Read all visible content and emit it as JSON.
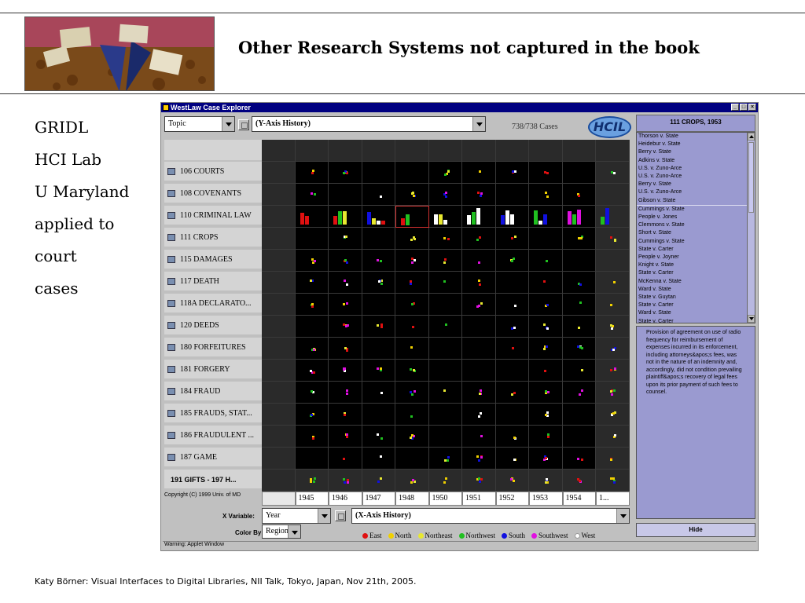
{
  "slide": {
    "title": "Other Research Systems not captured in the book",
    "side_lines": [
      "GRIDL",
      "HCI Lab",
      "U Maryland",
      "applied to",
      "court",
      "cases"
    ],
    "footer": "Katy Börner: Visual Interfaces to Digital Libraries, NII Talk, Tokyo, Japan, Nov 21th, 2005."
  },
  "app": {
    "window_title": "WestLaw Case Explorer",
    "y_dropdown": "Topic",
    "y_history": "(Y-Axis History)",
    "cases_count": "738/738 Cases",
    "logo_text": "HCIL",
    "x_variable_label": "X Variable:",
    "x_dropdown": "Year",
    "x_history": "(X-Axis History)",
    "color_by_label": "Color By:",
    "color_dropdown": "Region",
    "copyright": "Copyright (C) 1999 Univ. of MD",
    "status": "Warning: Applet Window",
    "rows": [
      "106 COURTS",
      "108 COVENANTS",
      "110 CRIMINAL LAW",
      "111 CROPS",
      "115 DAMAGES",
      "117 DEATH",
      "118A DECLARATO...",
      "120 DEEDS",
      "180 FORFEITURES",
      "181 FORGERY",
      "184 FRAUD",
      "185 FRAUDS, STAT...",
      "186 FRAUDULENT ...",
      "187 GAME"
    ],
    "row_last": "191 GIFTS - 197 H...",
    "columns": [
      "1945",
      "1946",
      "1947",
      "1948",
      "1950",
      "1951",
      "1952",
      "1953",
      "1954",
      "1..."
    ],
    "legend": [
      {
        "label": "East",
        "color": "#e01010"
      },
      {
        "label": "North",
        "color": "#f0d000"
      },
      {
        "label": "Northeast",
        "color": "#e8e830"
      },
      {
        "label": "Northwest",
        "color": "#20c020"
      },
      {
        "label": "South",
        "color": "#1010e0"
      },
      {
        "label": "Southwest",
        "color": "#e010e0"
      },
      {
        "label": "West",
        "color": "#ffffff"
      }
    ]
  },
  "details": {
    "title": "111 CROPS, 1953",
    "cases": [
      "Thorson v. State",
      "Heidebur v. State",
      "Berry v. State",
      "Adkins v. State",
      "U.S. v. Zuno-Arce",
      "U.S. v. Zuno-Arce",
      "Berry v. State",
      "U.S. v. Zuno-Arce",
      "Gibson v. State",
      "Cummings v. State",
      "People v. Jones",
      "Clemmons v. State",
      "Short v. State",
      "Cummings v. State",
      "State v. Carter",
      "People v. Joyner",
      "Knight v. State",
      "State v. Carter",
      "McKenna v. State",
      "Ward v. State",
      "State v. Guytan",
      "State v. Carter",
      "Ward v. State",
      "State v. Carter"
    ],
    "description": "Provision of agreement on use of radio frequency for reimbursement of expenses incurred in its enforcement, including attorneys&apos;s fees, was not in the nature of an indemnity and, accordingly, did not condition prevailing plaintiff&apos;s recovery of legal fees upon its prior payment of such fees to counsel.",
    "hide_label": "Hide"
  }
}
